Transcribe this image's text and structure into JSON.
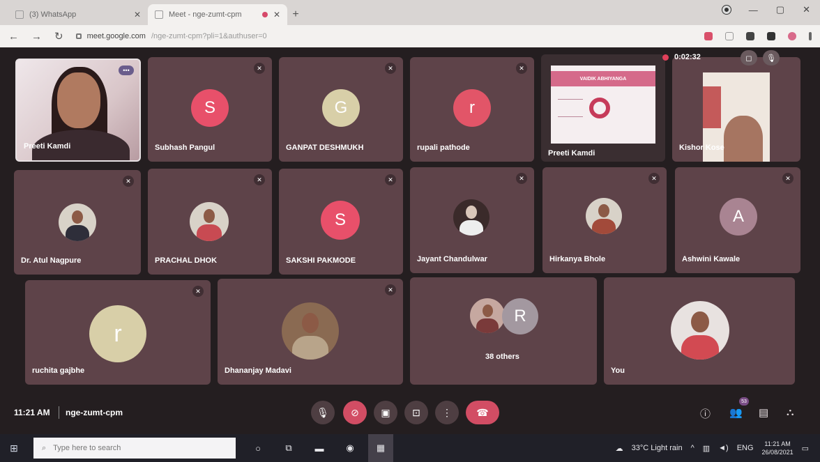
{
  "browser": {
    "tabs": [
      {
        "title": "(3) WhatsApp",
        "active": false
      },
      {
        "title": "Meet - nge-zumt-cpm",
        "active": true
      }
    ],
    "new_tab": "+",
    "address": {
      "host": "meet.google.com",
      "path": "/nge-zumt-cpm?pli=1&authuser=0"
    }
  },
  "meeting": {
    "recording_time": "0:02:32",
    "participants": [
      {
        "name": "Preeti Kamdi",
        "type": "video"
      },
      {
        "name": "Subhash Pangul",
        "initial": "S",
        "color": "#e8506a",
        "muted": true
      },
      {
        "name": "GANPAT DESHMUKH",
        "initial": "G",
        "color": "#d8cfa8",
        "muted": true
      },
      {
        "name": "rupali pathode",
        "initial": "r",
        "color": "#e25568",
        "muted": true
      },
      {
        "name": "Preeti Kamdi",
        "type": "presentation",
        "slide_title": "VAIDIK ABHIYANGA"
      },
      {
        "name": "Kishor Kose",
        "type": "video"
      },
      {
        "name": "Dr. Atul Nagpure",
        "type": "photo",
        "muted": true
      },
      {
        "name": "PRACHAL DHOK",
        "type": "photo",
        "muted": true
      },
      {
        "name": "SAKSHI PAKMODE",
        "initial": "S",
        "color": "#e8506a",
        "muted": true
      },
      {
        "name": "Jayant Chandulwar",
        "type": "photo",
        "muted": true
      },
      {
        "name": "Hirkanya Bhole",
        "type": "photo",
        "muted": true
      },
      {
        "name": "Ashwini Kawale",
        "initial": "A",
        "color": "#a98492",
        "muted": true
      },
      {
        "name": "ruchita gajbhe",
        "initial": "r",
        "color": "#d8cfa8",
        "muted": true
      },
      {
        "name": "Dhananjay Madavi",
        "type": "photo",
        "muted": true
      },
      {
        "name": "38 others",
        "type": "others",
        "initial": "R",
        "color": "#a398a0"
      },
      {
        "name": "You",
        "type": "photo"
      }
    ],
    "footer": {
      "time": "11:21 AM",
      "meeting_code": "nge-zumt-cpm",
      "people_badge": "53"
    }
  },
  "taskbar": {
    "search_placeholder": "Type here to search",
    "weather": "33°C  Light rain",
    "language": "ENG",
    "clock_time": "11:21 AM",
    "clock_date": "26/08/2021"
  }
}
